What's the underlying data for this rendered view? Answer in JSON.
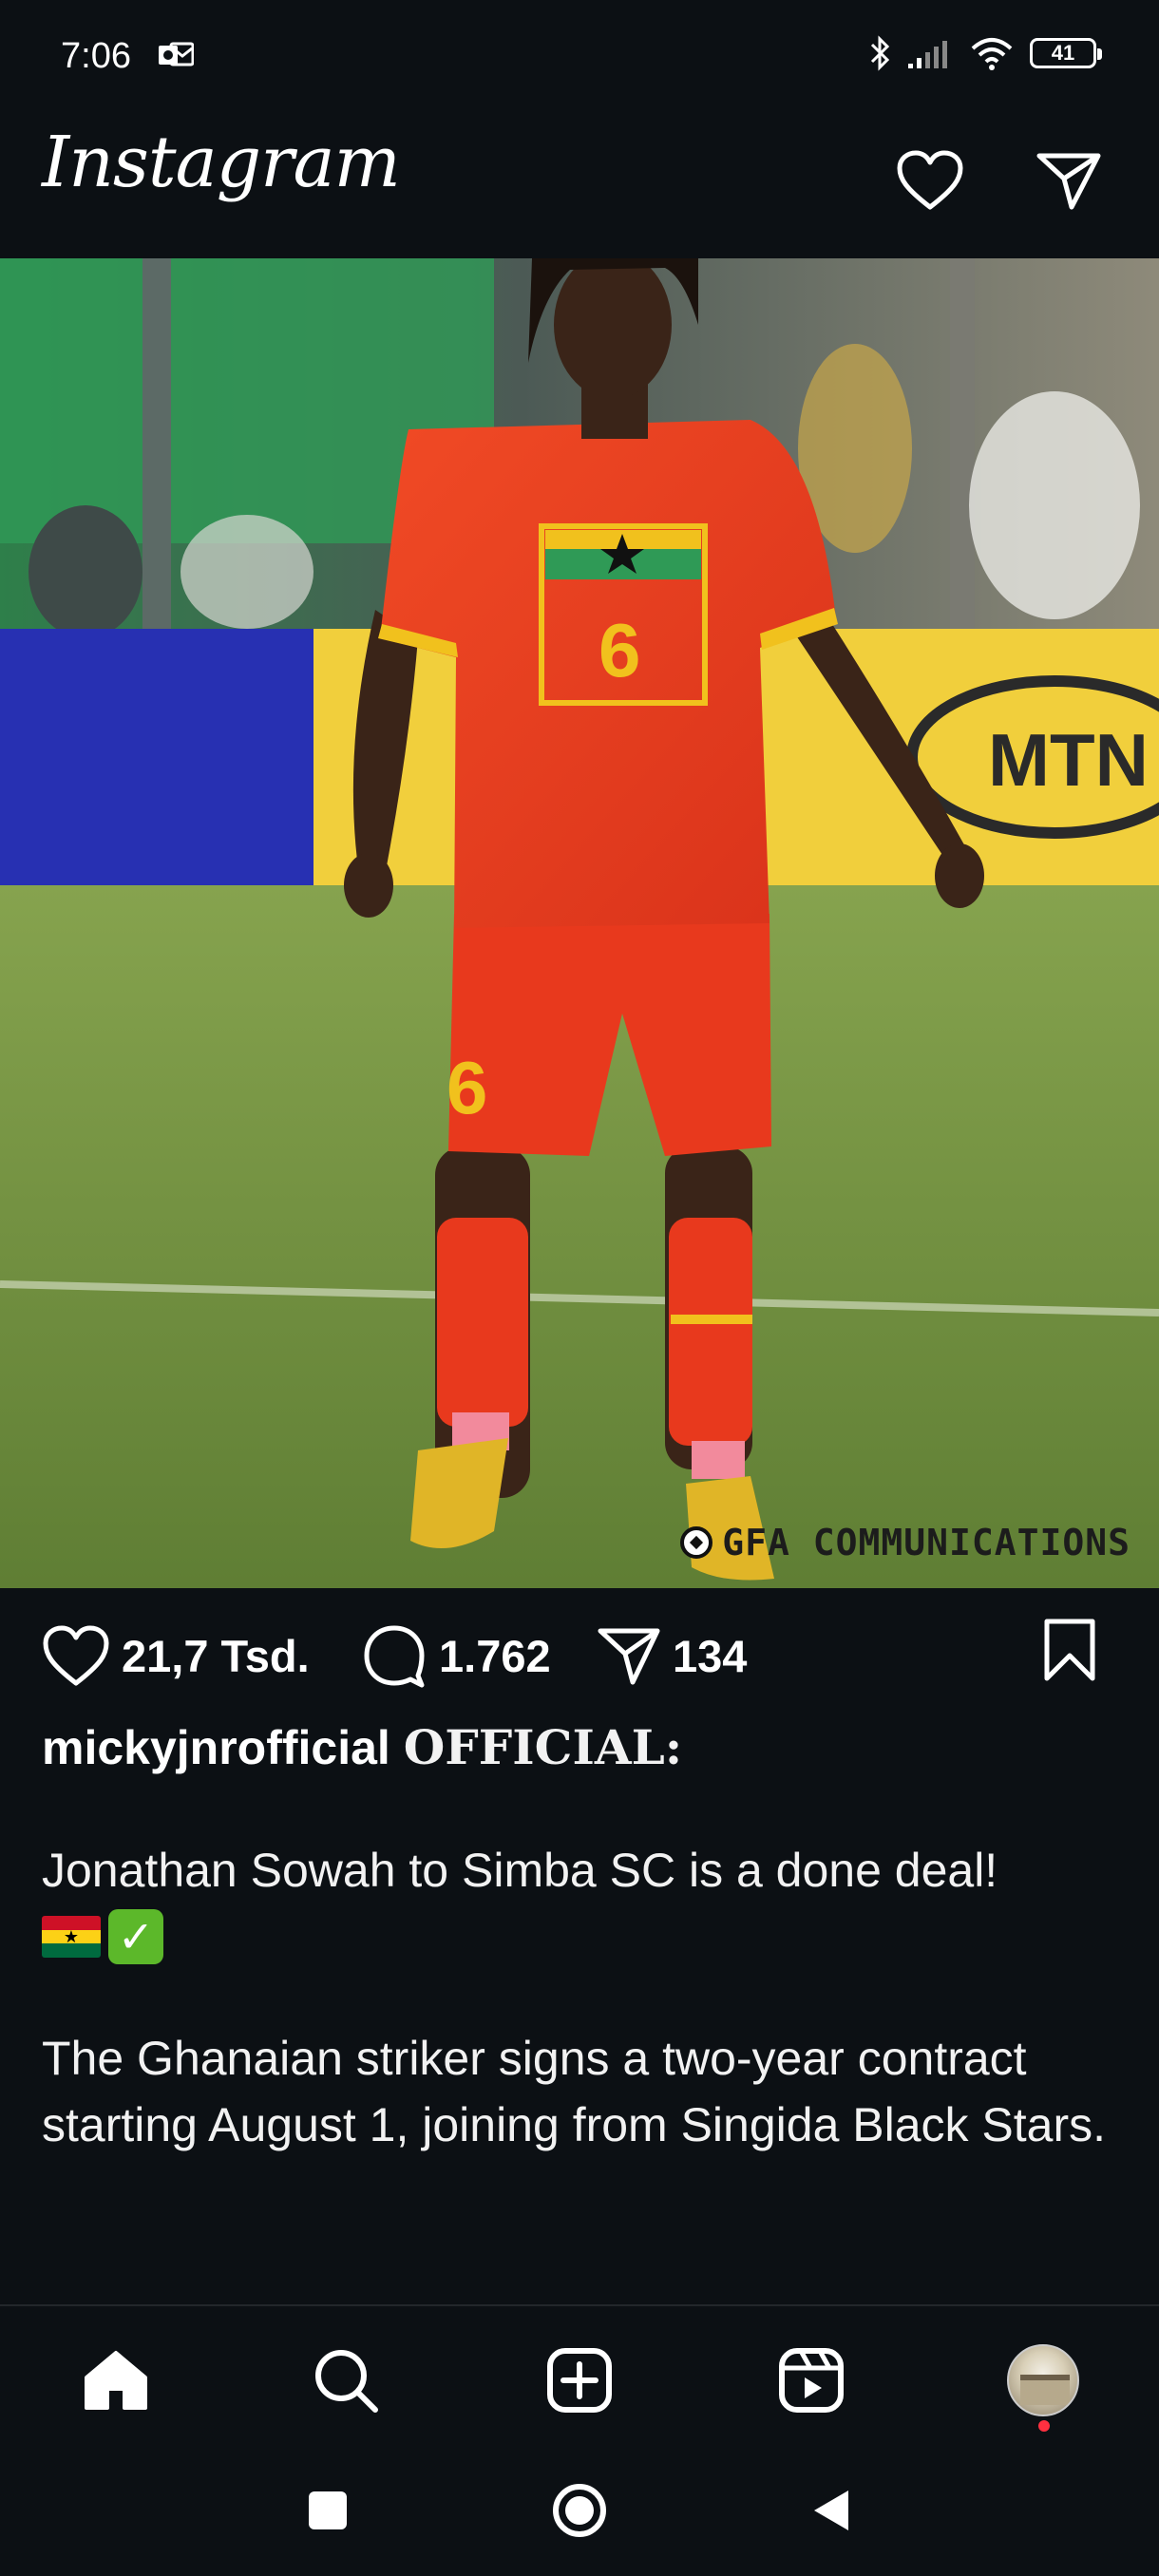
{
  "status_bar": {
    "time": "7:06",
    "battery": "41"
  },
  "header": {
    "logo": "Instagram",
    "icons": [
      "heart-icon",
      "send-icon"
    ]
  },
  "post": {
    "image_watermark": "GFA COMMUNICATIONS",
    "likes": "21,7 Tsd.",
    "comments": "1.762",
    "shares": "134",
    "caption": {
      "username": "mickyjnrofficial",
      "tag": "OFFICIAL",
      "separator": ":",
      "paragraph1": "Jonathan Sowah to Simba SC is a done deal!",
      "paragraph2": "The Ghanaian striker signs a two-year contract starting August 1, joining from Singida Black Stars."
    }
  },
  "colors": {
    "background": "#0c1014",
    "notification_dot": "#ff3040",
    "jersey_red": "#e8391d"
  },
  "bottom_nav": [
    "home-icon",
    "search-icon",
    "create-icon",
    "reels-icon",
    "profile-avatar"
  ],
  "system_nav": [
    "recents-button",
    "home-button",
    "back-button"
  ]
}
